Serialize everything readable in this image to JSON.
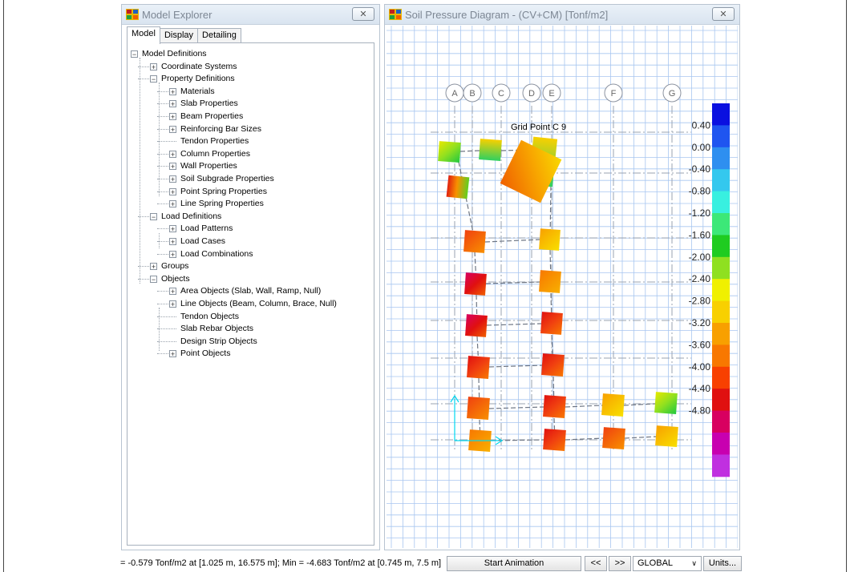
{
  "explorer": {
    "title": "Model Explorer",
    "tabs": [
      "Model",
      "Display",
      "Detailing"
    ],
    "tree": [
      {
        "label": "Model Definitions",
        "level": 0,
        "expander": "−"
      },
      {
        "label": "Coordinate Systems",
        "level": 1,
        "expander": "+"
      },
      {
        "label": "Property Definitions",
        "level": 1,
        "expander": "−"
      },
      {
        "label": "Materials",
        "level": 2,
        "expander": "+"
      },
      {
        "label": "Slab Properties",
        "level": 2,
        "expander": "+"
      },
      {
        "label": "Beam Properties",
        "level": 2,
        "expander": "+"
      },
      {
        "label": "Reinforcing Bar Sizes",
        "level": 2,
        "expander": "+"
      },
      {
        "label": "Tendon Properties",
        "level": 2,
        "expander": ""
      },
      {
        "label": "Column Properties",
        "level": 2,
        "expander": "+"
      },
      {
        "label": "Wall Properties",
        "level": 2,
        "expander": "+"
      },
      {
        "label": "Soil Subgrade Properties",
        "level": 2,
        "expander": "+"
      },
      {
        "label": "Point Spring Properties",
        "level": 2,
        "expander": "+"
      },
      {
        "label": "Line Spring Properties",
        "level": 2,
        "expander": "+"
      },
      {
        "label": "Load Definitions",
        "level": 1,
        "expander": "−"
      },
      {
        "label": "Load Patterns",
        "level": 2,
        "expander": "+"
      },
      {
        "label": "Load Cases",
        "level": 2,
        "expander": "+"
      },
      {
        "label": "Load Combinations",
        "level": 2,
        "expander": "+"
      },
      {
        "label": "Groups",
        "level": 1,
        "expander": "+"
      },
      {
        "label": "Objects",
        "level": 1,
        "expander": "−"
      },
      {
        "label": "Area Objects (Slab, Wall, Ramp, Null)",
        "level": 2,
        "expander": "+"
      },
      {
        "label": "Line Objects (Beam, Column, Brace, Null)",
        "level": 2,
        "expander": "+"
      },
      {
        "label": "Tendon Objects",
        "level": 2,
        "expander": ""
      },
      {
        "label": "Slab Rebar Objects",
        "level": 2,
        "expander": ""
      },
      {
        "label": "Design Strip Objects",
        "level": 2,
        "expander": ""
      },
      {
        "label": "Point Objects",
        "level": 2,
        "expander": "+"
      }
    ]
  },
  "diagram": {
    "title": "Soil Pressure Diagram - (CV+CM)  [Tonf/m2]",
    "grid_labels": [
      "A",
      "B",
      "C",
      "D",
      "E",
      "F",
      "G"
    ],
    "tooltip": "Grid Point  C  9",
    "legend_values": [
      "0.40",
      "0.00",
      "-0.40",
      "-0.80",
      "-1.20",
      "-1.60",
      "-2.00",
      "-2.40",
      "-2.80",
      "-3.20",
      "-3.60",
      "-4.00",
      "-4.40",
      "-4.80"
    ],
    "legend_colors": [
      "#0a10e0",
      "#1f55f0",
      "#2e8ff0",
      "#34c8ee",
      "#38f0e0",
      "#3ce878",
      "#1fcc20",
      "#8fe020",
      "#f0f000",
      "#f8d000",
      "#f8a000",
      "#f87800",
      "#f84000",
      "#e01010",
      "#d80060",
      "#c800b0",
      "#c030e0"
    ],
    "accent_cyan": "#00d8f0"
  },
  "status": {
    "coords_text": "= -0.579 Tonf/m2 at [1.025 m, 16.575 m];  Min = -4.683 Tonf/m2 at [0.745 m, 7.5 m]",
    "start_animation": "Start Animation",
    "prev": "<<",
    "next": ">>",
    "system": "GLOBAL",
    "units": "Units..."
  }
}
